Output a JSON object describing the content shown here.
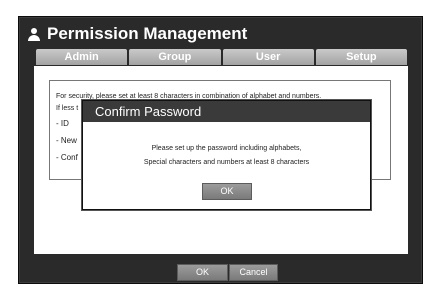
{
  "window": {
    "title": "Permission Management"
  },
  "tabs": [
    "Admin",
    "Group",
    "User",
    "Setup"
  ],
  "panel": {
    "line1": "For security, please set at least 8 characters in combination of alphabet and numbers.",
    "line2": "If less t",
    "fields": [
      "- ID",
      "- New",
      "- Conf"
    ]
  },
  "footer": {
    "ok_label": "OK",
    "cancel_label": "Cancel"
  },
  "dialog": {
    "title": "Confirm Password",
    "message_line1": "Please set up the password including alphabets,",
    "message_line2": "Special characters and numbers at least 8 characters",
    "ok_label": "OK"
  },
  "colors": {
    "window_bg": "#2a2a2a",
    "tab_bg": "#b5b5b5",
    "dialog_title_bg": "#3a3a3a",
    "button_bg": "#8a8a8a"
  }
}
